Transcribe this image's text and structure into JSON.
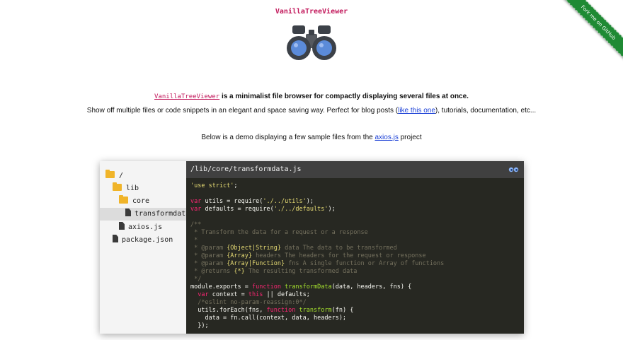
{
  "header": {
    "title": "VanillaTreeViewer",
    "ribbon": "Fork me on GitHub"
  },
  "intro": {
    "name": "VanillaTreeViewer",
    "lead": "is a minimalist file browser for compactly displaying several files at once.",
    "sub_before": "Show off multiple files or code snippets in an elegant and space saving way. Perfect for blog posts (",
    "sub_link": "like this one",
    "sub_after": "), tutorials, documentation, etc...",
    "demo_before": "Below is a demo displaying a few sample files from the ",
    "demo_link": "axios.js",
    "demo_after": " project"
  },
  "tree": {
    "items": [
      {
        "label": "/",
        "type": "folder"
      },
      {
        "label": "lib",
        "type": "folder"
      },
      {
        "label": "core",
        "type": "folder"
      },
      {
        "label": "transformdata.js",
        "type": "file",
        "selected": true
      },
      {
        "label": "axios.js",
        "type": "file"
      },
      {
        "label": "package.json",
        "type": "file"
      }
    ]
  },
  "editor": {
    "path": "/lib/core/transformdata.js",
    "code": [
      "'use strict';",
      "",
      "var utils = require('./../utils');",
      "var defaults = require('./../defaults');",
      "",
      "/**",
      " * Transform the data for a request or a response",
      " *",
      " * @param {Object|String} data The data to be transformed",
      " * @param {Array} headers The headers for the request or response",
      " * @param {Array|Function} fns A single function or Array of functions",
      " * @returns {*} The resulting transformed data",
      " */",
      "module.exports = function transformData(data, headers, fns) {",
      "  var context = this || defaults;",
      "  /*eslint no-param-reassign:0*/",
      "  utils.forEach(fns, function transform(fn) {",
      "    data = fn.call(context, data, headers);",
      "  });"
    ]
  },
  "colors": {
    "accent": "#c2185b",
    "link": "#1a3fd6",
    "ribbon": "#1f8a34",
    "editor_bg": "#272822",
    "folder": "#f0b429"
  }
}
